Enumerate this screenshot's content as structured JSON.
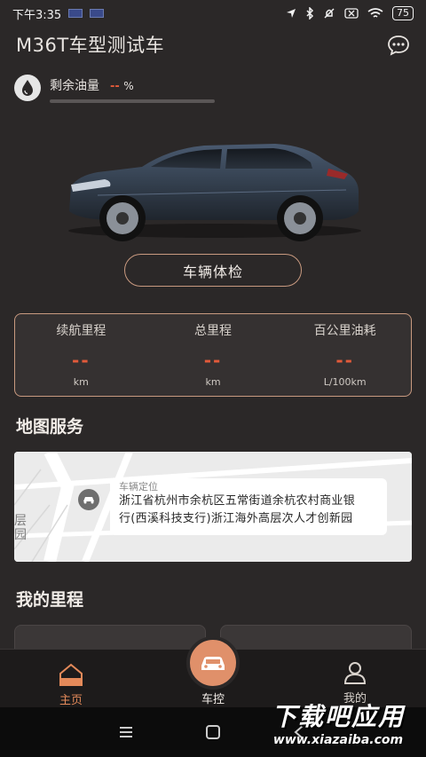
{
  "status_bar": {
    "time": "下午3:35",
    "battery": "75"
  },
  "header": {
    "title": "M36T车型测试车"
  },
  "fuel": {
    "label": "剩余油量",
    "value": "--",
    "unit": "%"
  },
  "check_button": {
    "label": "车辆体检"
  },
  "stats": [
    {
      "label": "续航里程",
      "value": "--",
      "unit": "km"
    },
    {
      "label": "总里程",
      "value": "--",
      "unit": "km"
    },
    {
      "label": "百公里油耗",
      "value": "--",
      "unit": "L/100km"
    }
  ],
  "map_section": {
    "title": "地图服务",
    "tag_label": "车辆定位",
    "address_line1": "浙江省杭州市余杭区五常街道余杭农村商业银",
    "address_line2": "行(西溪科技支行)浙江海外高层次人才创新园",
    "side_text_1": "层",
    "side_text_2": "园"
  },
  "mileage_section": {
    "title": "我的里程"
  },
  "bottom_nav": {
    "home": "主页",
    "control": "车控",
    "mine": "我的"
  },
  "watermark": {
    "main": "下载吧应用",
    "url": "www.xiazaiba.com"
  },
  "colors": {
    "accent": "#e0906a",
    "value_red": "#e25a3a",
    "background": "#2b2828"
  }
}
